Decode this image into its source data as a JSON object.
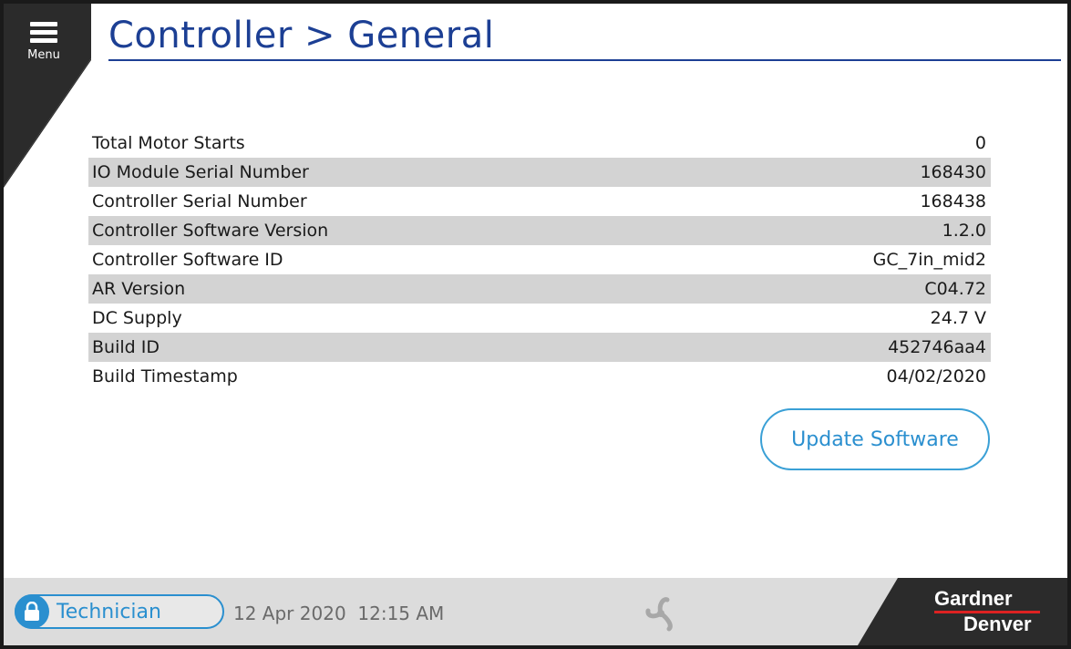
{
  "header": {
    "menu_label": "Menu",
    "title": "Controller > General"
  },
  "details": [
    {
      "label": "Total Motor Starts",
      "value": "0"
    },
    {
      "label": "IO Module Serial Number",
      "value": "168430"
    },
    {
      "label": "Controller Serial Number",
      "value": "168438"
    },
    {
      "label": "Controller Software Version",
      "value": "1.2.0"
    },
    {
      "label": "Controller Software ID",
      "value": "GC_7in_mid2"
    },
    {
      "label": "AR Version",
      "value": "C04.72"
    },
    {
      "label": "DC Supply",
      "value": "24.7 V"
    },
    {
      "label": "Build ID",
      "value": "452746aa4"
    },
    {
      "label": "Build Timestamp",
      "value": "04/02/2020"
    }
  ],
  "actions": {
    "update_label": "Update Software"
  },
  "footer": {
    "user_role": "Technician",
    "datetime": "12 Apr 2020  12:15 AM",
    "brand_line1": "Gardner",
    "brand_line2": "Denver"
  },
  "colors": {
    "title_blue": "#1c3f94",
    "accent_blue": "#2a8fcf",
    "row_alt_bg": "#d3d3d3",
    "brand_red": "#dd2222"
  },
  "icons": {
    "menu": "hamburger-icon",
    "lock": "lock-icon",
    "fan": "fan-icon"
  }
}
